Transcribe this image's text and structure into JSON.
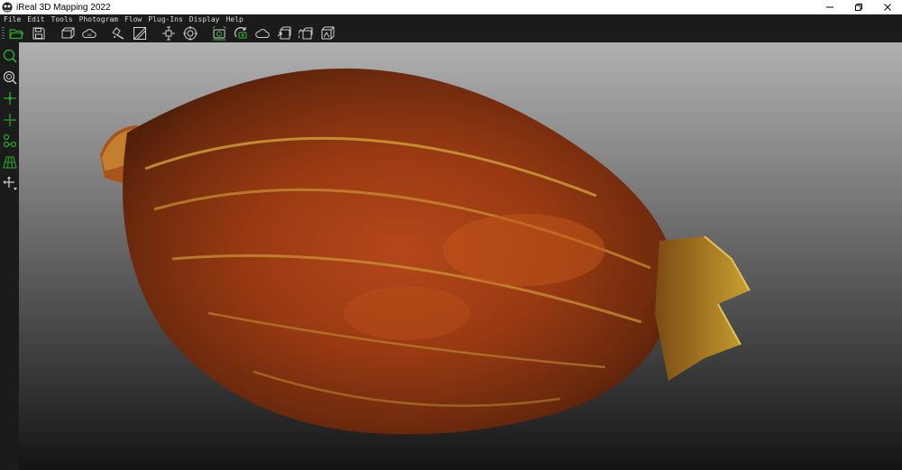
{
  "window": {
    "title": "iReal 3D Mapping 2022"
  },
  "menu": {
    "items": [
      "File",
      "Edit",
      "Tools",
      "Photogram",
      "Flow",
      "Plug-Ins",
      "Display",
      "Help"
    ]
  },
  "toolbar": {
    "buttons": [
      "open-folder-icon",
      "save-icon",
      "crop-model-icon",
      "cloud-icon",
      "clean-mesh-icon",
      "texture-icon",
      "drone-icon",
      "target-icon",
      "camera-refresh-icon",
      "camera-sync-icon",
      "cloud-outline-icon",
      "model-export-icon",
      "model-rotate-icon",
      "model-cube-icon"
    ]
  },
  "left_toolbar": {
    "buttons": [
      "zoom-icon",
      "zoom-fit-icon",
      "pivot-icon",
      "center-icon",
      "align-points-icon",
      "grid-icon",
      "move-icon"
    ]
  },
  "colors": {
    "accent": "#2ea62e",
    "viewport_top": "#b0b0b0",
    "viewport_bottom": "#141414"
  }
}
